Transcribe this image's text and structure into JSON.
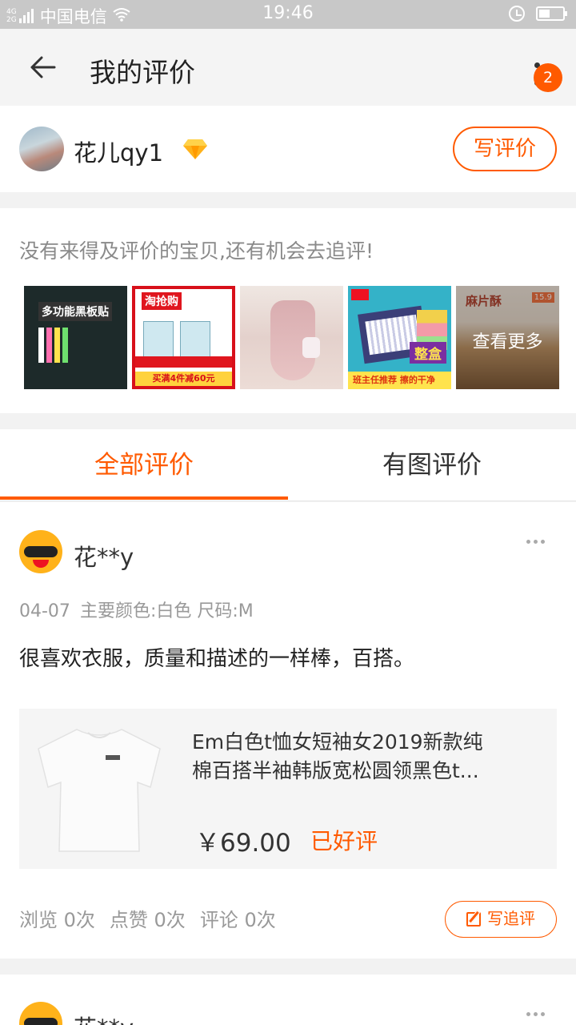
{
  "status_bar": {
    "network": "4G 2G",
    "carrier": "中国电信",
    "time": "19:46",
    "battery_level": 0.45
  },
  "header": {
    "title": "我的评价",
    "notification_count": "2"
  },
  "user": {
    "name": "花儿qy1",
    "write_review_label": "写评价"
  },
  "pending": {
    "tip": "没有来得及评价的宝贝,还有机会去追评!",
    "thumbnails": [
      {
        "text": "多功能黑板贴"
      },
      {
        "text": "淘抢购",
        "footer": "买满4件减60元"
      },
      {
        "text": ""
      },
      {
        "text": "整盒",
        "footer": "班主任推荐 擦的干净"
      },
      {
        "text": "麻片酥",
        "price": "15.9"
      }
    ],
    "see_more_label": "查看更多"
  },
  "tabs": [
    {
      "label": "全部评价",
      "active": true
    },
    {
      "label": "有图评价",
      "active": false
    }
  ],
  "reviews": [
    {
      "user": "花**y",
      "date": "04-07",
      "spec": "主要颜色:白色 尺码:M",
      "text": "很喜欢衣服，质量和描述的一样棒，百搭。",
      "product": {
        "name_line1": "Em白色t恤女短袖女2019新款纯",
        "name_line2": "棉百搭半袖韩版宽松圆领黑色t...",
        "price": "￥69.00",
        "status": "已好评"
      },
      "stats": {
        "views": "浏览 0次",
        "likes": "点赞 0次",
        "comments": "评论 0次"
      },
      "follow_up_label": "写追评"
    },
    {
      "user": "花**y"
    }
  ],
  "colors": {
    "accent": "#ff5a00",
    "status_bar": "#c8c8c8",
    "background": "#f2f2f2"
  }
}
